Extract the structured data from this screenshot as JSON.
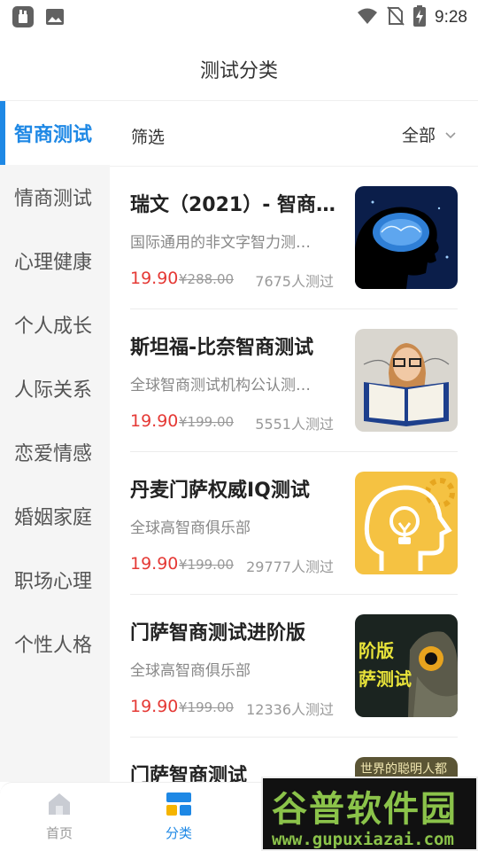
{
  "status_bar": {
    "time": "9:28"
  },
  "header": {
    "title": "测试分类"
  },
  "sidebar": {
    "items": [
      {
        "label": "智商测试",
        "active": true
      },
      {
        "label": "情商测试"
      },
      {
        "label": "心理健康"
      },
      {
        "label": "个人成长"
      },
      {
        "label": "人际关系"
      },
      {
        "label": "恋爱情感"
      },
      {
        "label": "婚姻家庭"
      },
      {
        "label": "职场心理"
      },
      {
        "label": "个性人格"
      }
    ]
  },
  "filter": {
    "label": "筛选",
    "selected": "全部"
  },
  "list": {
    "items": [
      {
        "title": "瑞文（2021）- 智商…",
        "desc": "国际通用的非文字智力测…",
        "price": "19.90",
        "original": "¥288.00",
        "count": "7675人测过",
        "thumb": "brain-image"
      },
      {
        "title": "斯坦福-比奈智商测试",
        "desc": "全球智商测试机构公认测…",
        "price": "19.90",
        "original": "¥199.00",
        "count": "5551人测过",
        "thumb": "reading-woman-image"
      },
      {
        "title": "丹麦门萨权威IQ测试",
        "desc": "全球高智商俱乐部",
        "price": "19.90",
        "original": "¥199.00",
        "count": "29777人测过",
        "thumb": "lightbulb-head-image"
      },
      {
        "title": "门萨智商测试进阶版",
        "desc": "全球高智商俱乐部",
        "price": "19.90",
        "original": "¥199.00",
        "count": "12336人测过",
        "thumb": "owl-image",
        "thumb_text": "阶版 萨测试"
      },
      {
        "title": "门萨智商测试",
        "thumb_text": "世界的聪明人都"
      }
    ]
  },
  "bottom_nav": {
    "items": [
      {
        "label": "首页"
      },
      {
        "label": "分类",
        "active": true
      }
    ]
  },
  "watermark": {
    "title": "谷普软件园",
    "url": "www.gupuxiazai.com"
  },
  "colors": {
    "accent": "#1e88e5",
    "price": "#e53935"
  }
}
